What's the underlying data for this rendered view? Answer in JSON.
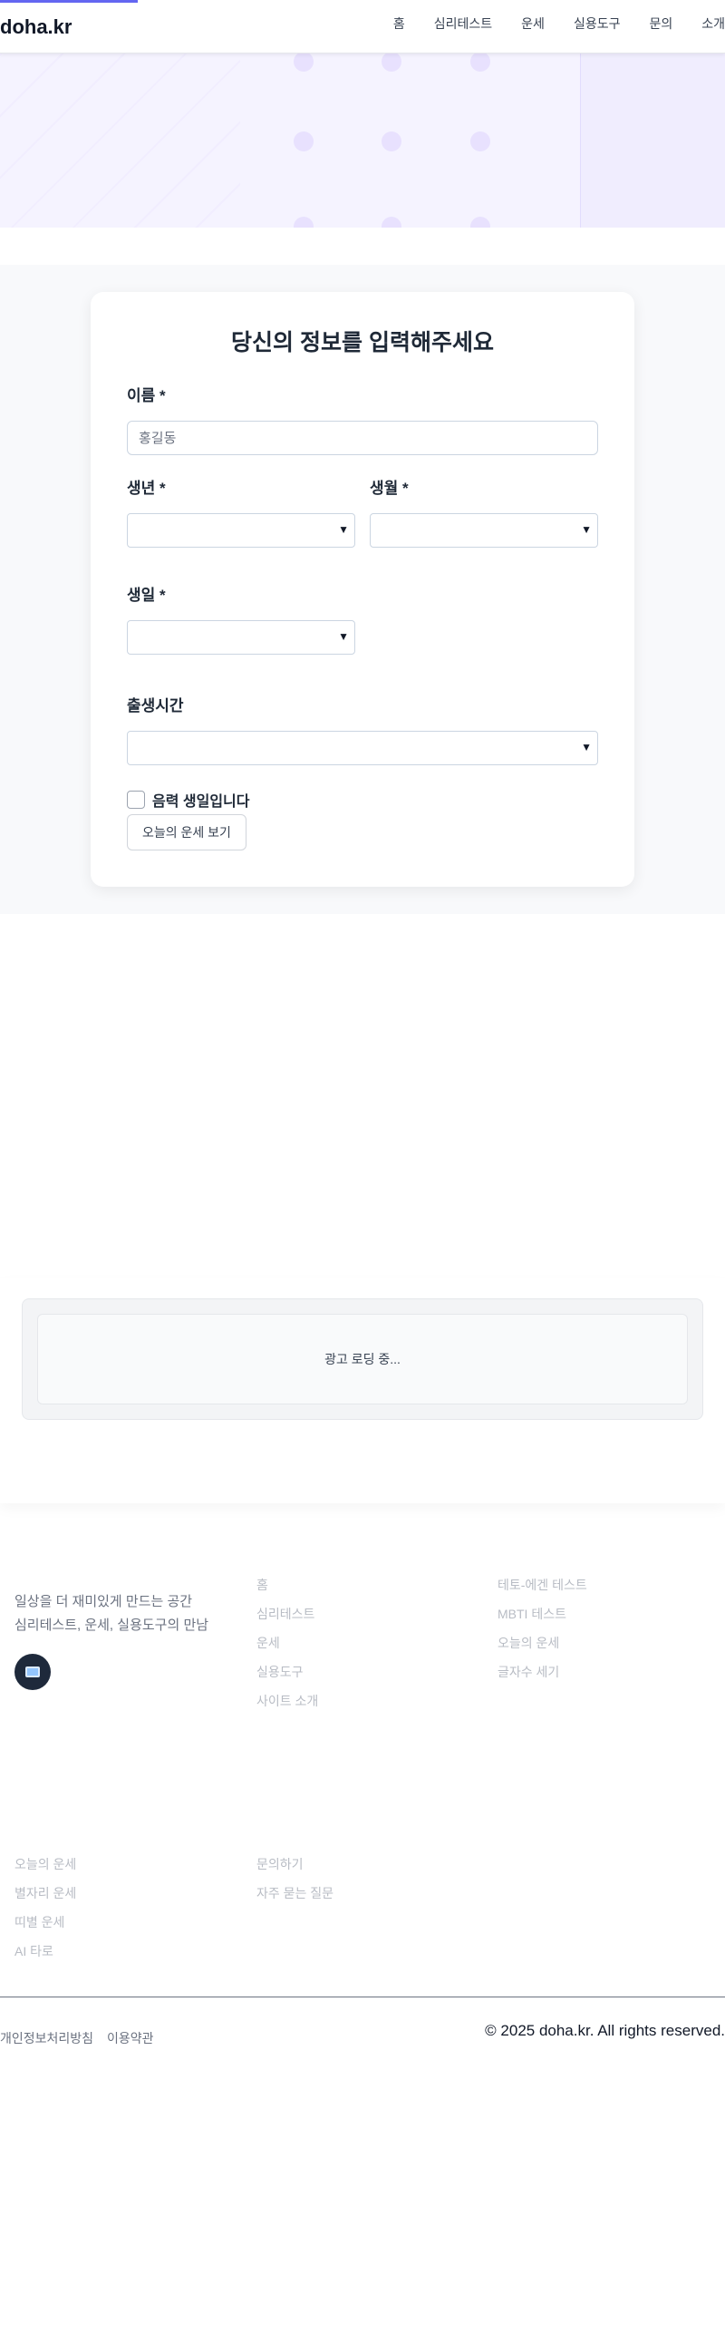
{
  "header": {
    "logo": "doha.kr",
    "nav": [
      "홈",
      "심리테스트",
      "운세",
      "실용도구",
      "문의",
      "소개"
    ]
  },
  "form": {
    "title": "당신의 정보를 입력해주세요",
    "name_label": "이름 *",
    "name_placeholder": "홍길동",
    "year_label": "생년 *",
    "month_label": "생월 *",
    "day_label": "생일 *",
    "time_label": "출생시간",
    "lunar_label": "음력 생일입니다",
    "submit_label": "오늘의 운세 보기"
  },
  "ad": {
    "loading_text": "광고 로딩 중..."
  },
  "footer": {
    "description_line1": "일상을 더 재미있게 만드는 공간",
    "description_line2": "심리테스트, 운세, 실용도구의 만남",
    "col2_links": [
      "홈",
      "심리테스트",
      "운세",
      "실용도구",
      "사이트 소개"
    ],
    "col3_links": [
      "테토-에겐 테스트",
      "MBTI 테스트",
      "오늘의 운세",
      "글자수 세기"
    ],
    "col1b_links": [
      "오늘의 운세",
      "별자리 운세",
      "띠별 운세",
      "AI 타로"
    ],
    "col2b_links": [
      "문의하기",
      "자주 묻는 질문"
    ],
    "legal": [
      "개인정보처리방침",
      "이용약관"
    ],
    "copyright": "© 2025 doha.kr. All rights reserved."
  },
  "colors": {
    "accent": "#6366f1",
    "hero_bg": "#f5f3ff",
    "section_bg": "#f8f9fb"
  },
  "icons": {
    "select_chevron": "chevron-down-icon",
    "footer_badge": "flag-icon"
  }
}
